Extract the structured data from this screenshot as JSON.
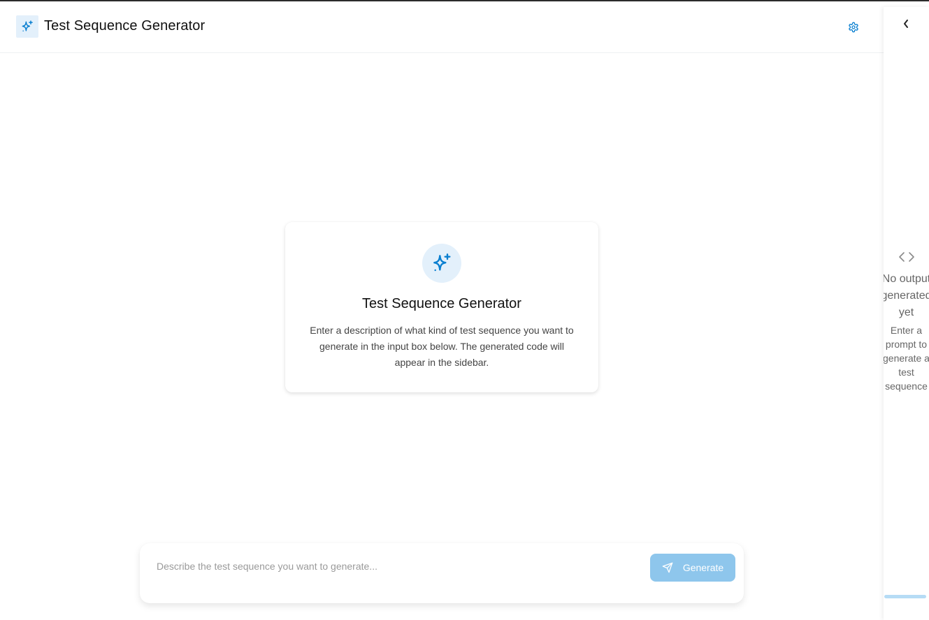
{
  "header": {
    "title": "Test Sequence Generator",
    "logo_icon": "sparkles-icon",
    "settings_icon": "gear-icon"
  },
  "welcome": {
    "icon": "sparkles-icon",
    "title": "Test Sequence Generator",
    "description": "Enter a description of what kind of test sequence you want to generate in the input box below. The generated code will appear in the sidebar."
  },
  "prompt": {
    "value": "",
    "placeholder": "Describe the test sequence you want to generate...",
    "generate_label": "Generate",
    "generate_icon": "send-icon"
  },
  "sidebar": {
    "collapse_icon": "chevron-left-icon",
    "empty_icon": "code-icon",
    "empty_title": "No output generated yet",
    "empty_subtitle": "Enter a prompt to generate a test sequence"
  },
  "colors": {
    "accent": "#0a7fd0",
    "accent_light": "#e3f0fb",
    "button_disabled": "#8ec6ec",
    "muted_text": "#666666"
  }
}
